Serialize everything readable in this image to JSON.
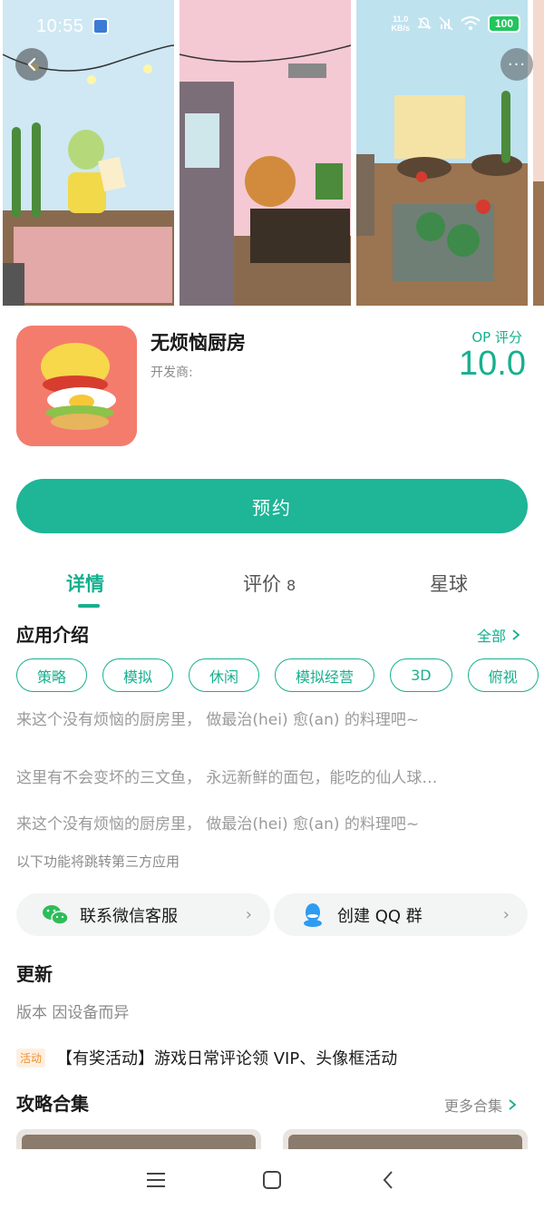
{
  "status_bar": {
    "time": "10:55",
    "net_speed_value": "11.0",
    "net_speed_unit": "KB/s",
    "battery": "100"
  },
  "app": {
    "name": "无烦恼厨房",
    "developer_label": "开发商:",
    "score_label": "OP 评分",
    "score": "10.0",
    "reserve_label": "预约"
  },
  "tabs": [
    {
      "label": "详情",
      "active": true
    },
    {
      "label": "评价",
      "count": "8",
      "active": false
    },
    {
      "label": "星球",
      "active": false
    }
  ],
  "intro": {
    "title": "应用介绍",
    "all_label": "全部",
    "tags": [
      "策略",
      "模拟",
      "休闲",
      "模拟经营",
      "3D",
      "俯视"
    ],
    "lines": [
      "来这个没有烦恼的厨房里， 做最治(hei) 愈(an) 的料理吧~",
      "这里有不会变坏的三文鱼， 永远新鲜的面包，能吃的仙人球…",
      "来这个没有烦恼的厨房里， 做最治(hei) 愈(an) 的料理吧~"
    ],
    "third_party_note": "以下功能将跳转第三方应用"
  },
  "contacts": [
    {
      "label": "联系微信客服",
      "icon": "wechat-icon"
    },
    {
      "label": "创建 QQ 群",
      "icon": "qq-icon"
    }
  ],
  "update": {
    "title": "更新",
    "version": "版本 因设备而异"
  },
  "activity": {
    "badge": "活动",
    "text": "【有奖活动】游戏日常评论领 VIP、头像框活动"
  },
  "guides": {
    "title": "攻略合集",
    "more_label": "更多合集"
  },
  "colors": {
    "accent": "#16b08f",
    "button": "#1fb597",
    "icon_bg": "#f47c6c"
  }
}
